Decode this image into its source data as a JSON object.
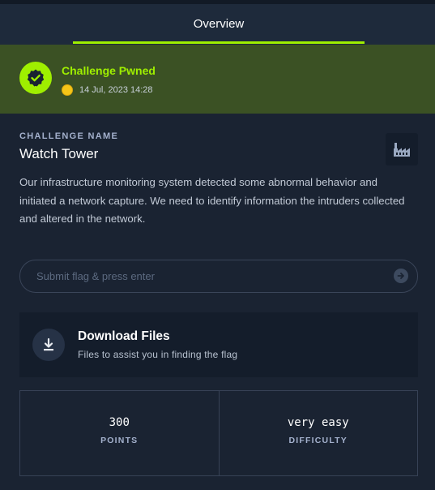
{
  "tabs": {
    "overview_label": "Overview"
  },
  "status": {
    "title": "Challenge Pwned",
    "timestamp": "14 Jul, 2023 14:28",
    "accent_color": "#9fef00",
    "badge_icon": "verified-check-icon",
    "coin_icon": "coin-icon"
  },
  "challenge": {
    "section_label": "CHALLENGE NAME",
    "name": "Watch Tower",
    "category_icon": "factory-icon",
    "description": "Our infrastructure monitoring system detected some abnormal behavior and initiated a network capture. We need to identify information the intruders collected and altered in the network."
  },
  "flag": {
    "placeholder": "Submit flag & press enter",
    "value": "",
    "submit_icon": "arrow-right-circle-icon"
  },
  "download": {
    "title": "Download Files",
    "subtitle": "Files to assist you in finding the flag",
    "icon": "download-icon"
  },
  "stats": {
    "points_value": "300",
    "points_label": "POINTS",
    "difficulty_value": "very easy",
    "difficulty_label": "DIFFICULTY"
  }
}
